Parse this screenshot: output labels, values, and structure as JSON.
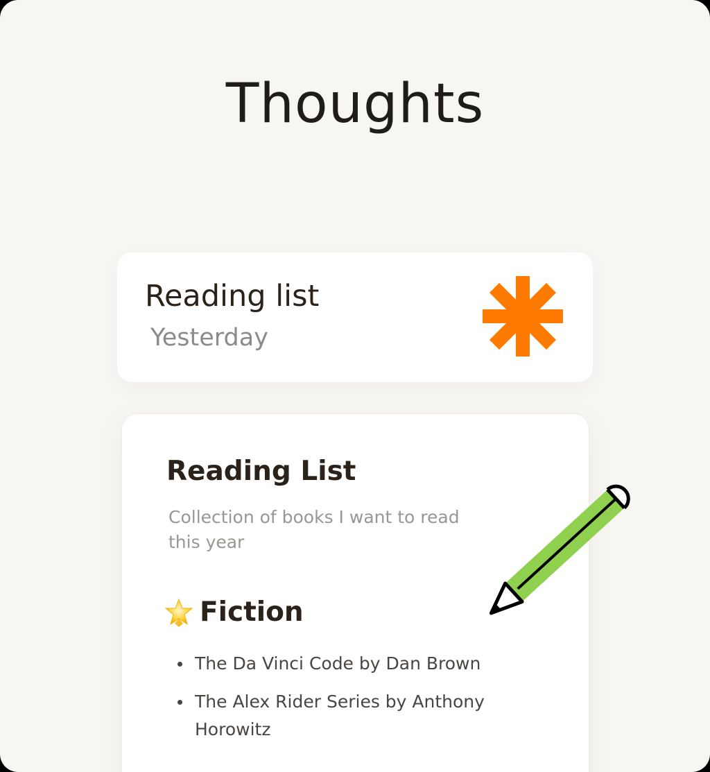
{
  "header": {
    "title": "Thoughts"
  },
  "note_card": {
    "title": "Reading list",
    "date": "Yesterday",
    "icon": "asterisk-icon",
    "icon_color": "#ff7a00"
  },
  "doc_card": {
    "title": "Reading List",
    "subtitle": "Collection of books I want to read this year",
    "section": {
      "icon": "star-icon",
      "heading": "Fiction"
    },
    "items": [
      {
        "label": "The Da Vinci Code by Dan Brown"
      },
      {
        "label": "The Alex Rider Series by Anthony Horowitz"
      }
    ]
  },
  "decoration": {
    "icon": "pencil-icon",
    "pencil_color": "#8fd14f"
  },
  "colors": {
    "background": "#f8f6f3",
    "card": "#ffffff",
    "text_primary": "#2b2219",
    "text_muted": "#9a9691",
    "accent_orange": "#ff7a00",
    "accent_green": "#8fd14f"
  }
}
